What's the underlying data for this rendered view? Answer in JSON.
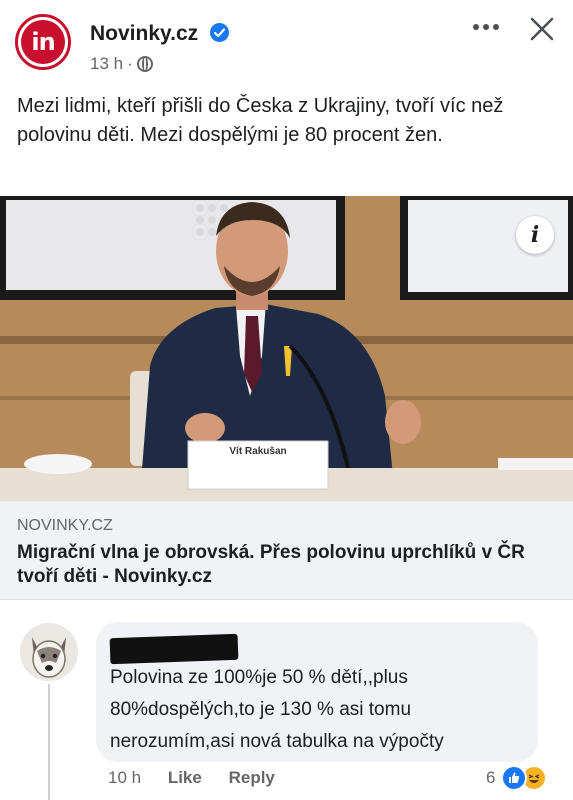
{
  "post": {
    "page_name": "Novinky.cz",
    "page_logo_text": "in",
    "time": "13 h",
    "separator": "·",
    "text": "Mezi lidmi, kteří přišli do Česka z Ukrajiny, tvoří víc než polovinu děti. Mezi dospělými je 80 procent žen.",
    "more_icon": "ellipsis-icon",
    "close_icon": "close-icon"
  },
  "photo": {
    "nameplate": "Vít Rakušan",
    "info_label": "i",
    "colors": {
      "wall": "#b78a5b",
      "suit": "#1f2a44",
      "tie": "#5a1a2c"
    }
  },
  "link": {
    "domain": "NOVINKY.CZ",
    "title": "Migrační vlna je obrovská. Přes polovinu uprchlíků v ČR tvoří děti - Novinky.cz"
  },
  "comment": {
    "author": "",
    "text": "Polovina ze 100%je 50 % dětí,,plus 80%dospělých,to je 130 %  asi tomu nerozumím,asi nová tabulka na výpočty",
    "time": "10 h",
    "like_label": "Like",
    "reply_label": "Reply",
    "reaction_count": "6"
  },
  "colors": {
    "brand_red": "#c8102e",
    "facebook_blue": "#1877f2",
    "bubble_bg": "#f0f2f5",
    "secondary_text": "#65676b"
  }
}
